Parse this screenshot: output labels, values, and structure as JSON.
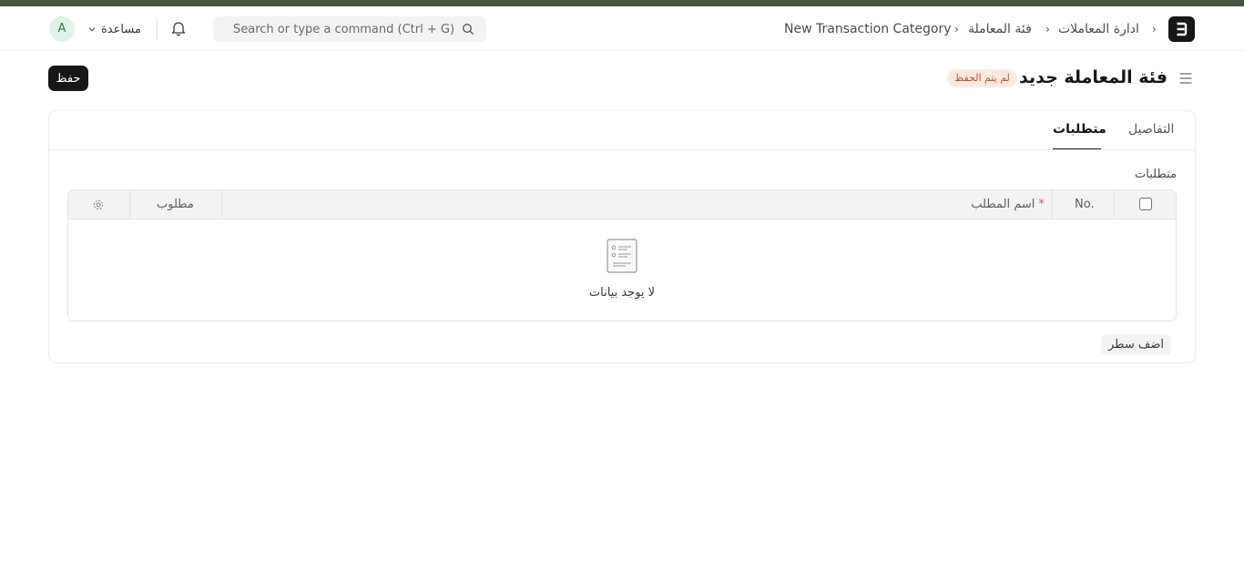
{
  "navbar": {
    "avatar_initial": "A",
    "help_label": "مساعدة",
    "search_placeholder": "Search or type a command (Ctrl + G)",
    "breadcrumbs": [
      "ادارة المعاملات",
      "فئة المعاملة",
      "New Transaction Category"
    ],
    "logo_letter": "E"
  },
  "header": {
    "title": "فئة المعاملة جديد",
    "status_badge": "لم يتم الحفظ",
    "save_label": "حفظ"
  },
  "tabs": [
    {
      "label": "التفاصيل",
      "active": false
    },
    {
      "label": "متطلبات",
      "active": true
    }
  ],
  "section": {
    "label": "متطلبات",
    "table": {
      "columns": {
        "no": "No.",
        "requirement_name": "اسم المطلب",
        "required_marker": "*",
        "required": "مطلوب"
      },
      "empty_text": "لا يوجد بيانات",
      "add_row_label": "اضف سطر"
    }
  },
  "colors": {
    "top_strip": "#44573f",
    "primary_button": "#171717",
    "badge_bg": "#fde9e0",
    "badge_text": "#c2552f",
    "avatar_bg": "#dff3e6"
  }
}
